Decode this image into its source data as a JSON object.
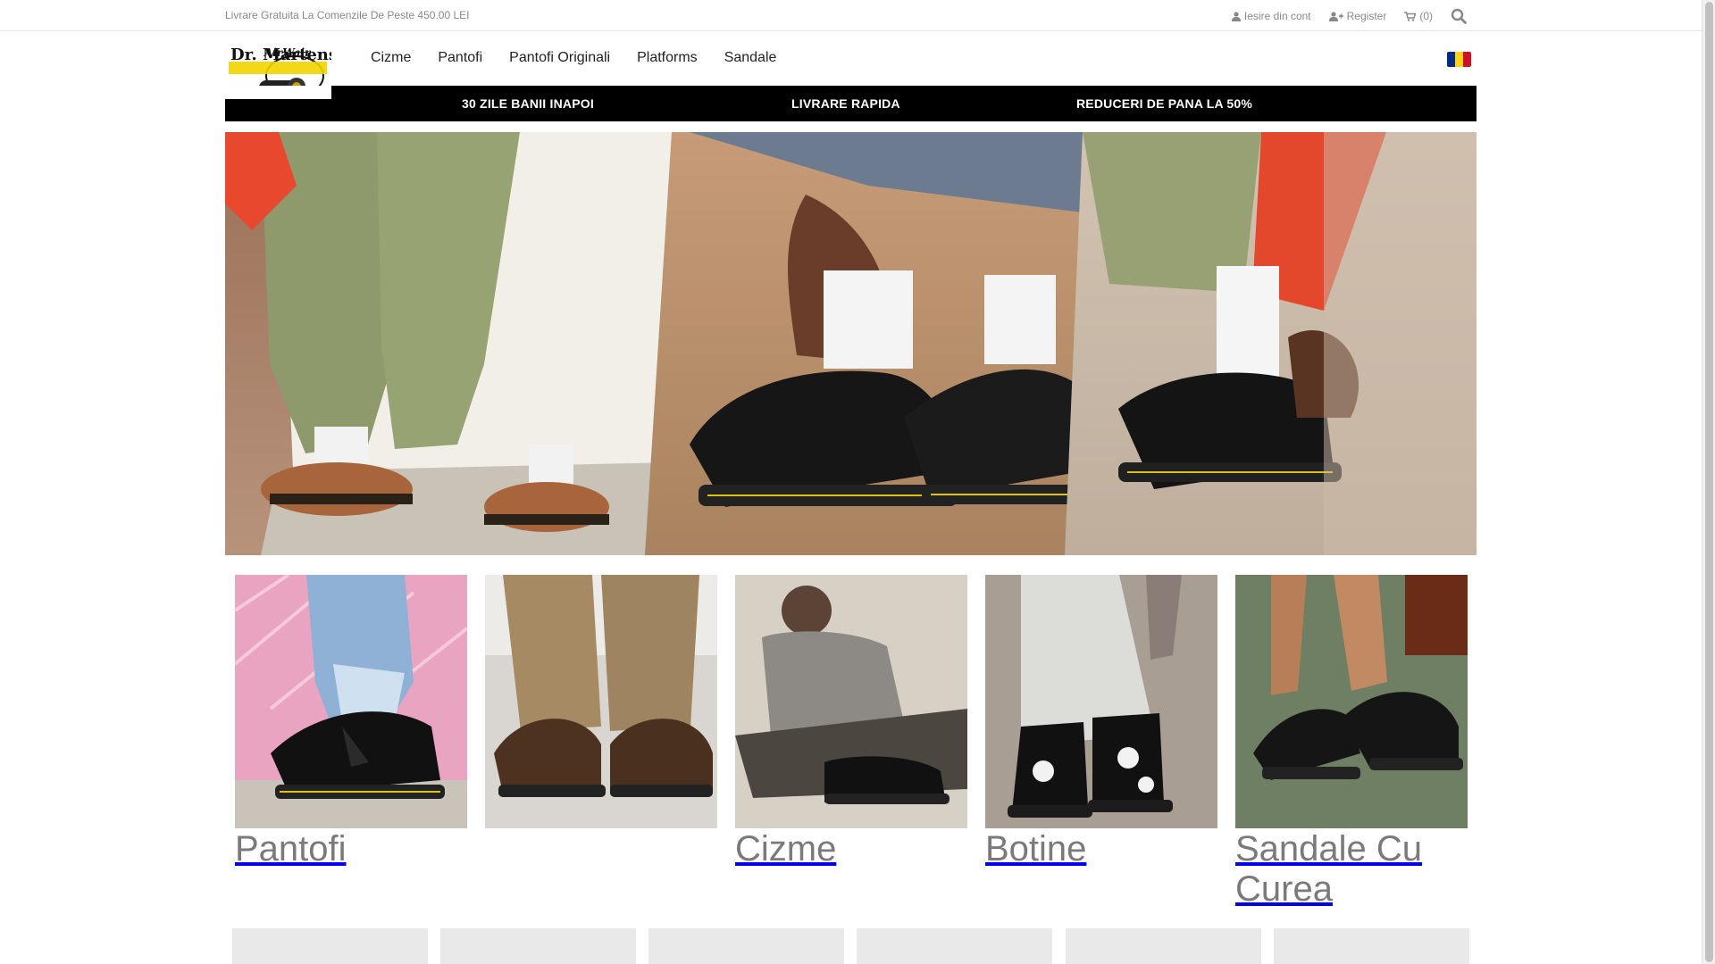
{
  "topbar": {
    "promo": "Livrare Gratuita La Comenzile De Peste 450.00 LEI",
    "logout": "Iesire din cont",
    "register": "Register",
    "cart": "(0)",
    "icons": {
      "logout": "user-icon",
      "register": "user-plus-icon",
      "cart": "cart-icon",
      "search": "search-icon"
    }
  },
  "logo": {
    "brand": "Dr. Martens",
    "sub": "AirWair"
  },
  "nav": {
    "items": [
      "Cizme",
      "Pantofi",
      "Pantofi Originali",
      "Platforms",
      "Sandale"
    ]
  },
  "language_flag": {
    "name": "Romania",
    "colors": [
      "#002b7f",
      "#fcd116",
      "#ce1126"
    ]
  },
  "benefits": {
    "item1": "30 ZILE BANII INAPOI",
    "item2": "LIVRARE RAPIDA",
    "item3": "REDUCERI DE PANA LA 50%"
  },
  "categories": [
    {
      "label": "Pantofi"
    },
    {
      "label": ""
    },
    {
      "label": "Cizme"
    },
    {
      "label": "Botine"
    },
    {
      "label": "Sandale Cu Curea"
    }
  ],
  "colors": {
    "accent_black": "#000000",
    "text_muted": "#888888",
    "category_label": "#7a7a7a"
  }
}
